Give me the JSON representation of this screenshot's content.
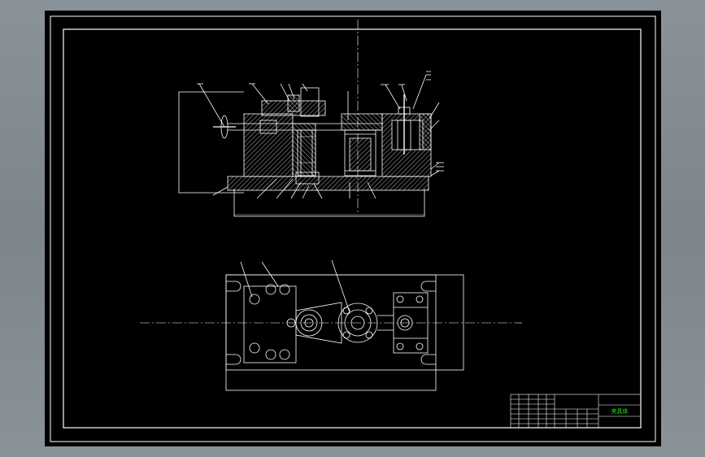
{
  "drawing": {
    "title_cell": "夹具体",
    "colors": {
      "background": "#000000",
      "lines": "#ffffff",
      "title_text": "#00ff00",
      "viewport": "#8a9299"
    }
  }
}
